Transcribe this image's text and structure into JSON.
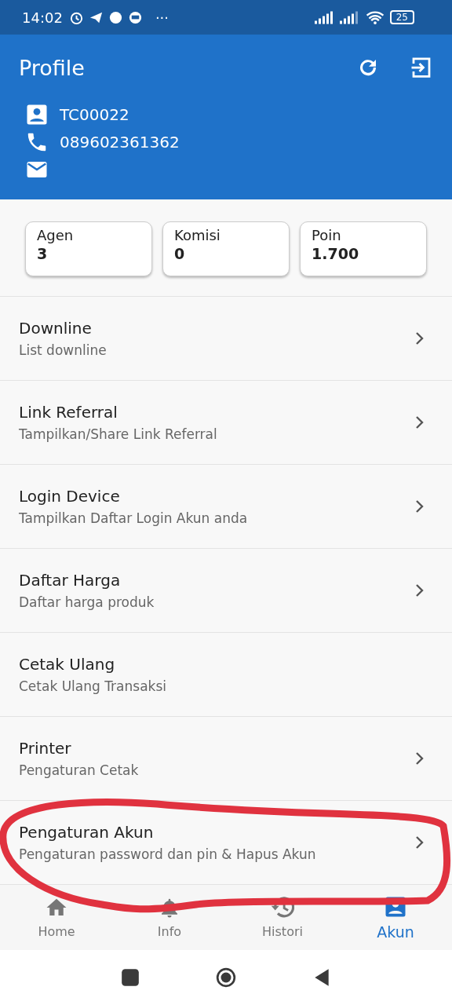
{
  "status_bar": {
    "time": "14:02",
    "more": "···",
    "battery": "25"
  },
  "header": {
    "title": "Profile",
    "user_id": "TC00022",
    "phone": "089602361362"
  },
  "stats": [
    {
      "label": "Agen",
      "value": "3"
    },
    {
      "label": "Komisi",
      "value": "0"
    },
    {
      "label": "Poin",
      "value": "1.700"
    }
  ],
  "menu": [
    {
      "title": "Downline",
      "subtitle": "List downline",
      "chevron": true
    },
    {
      "title": "Link Referral",
      "subtitle": "Tampilkan/Share Link Referral",
      "chevron": true
    },
    {
      "title": "Login Device",
      "subtitle": "Tampilkan Daftar Login Akun anda",
      "chevron": true
    },
    {
      "title": "Daftar Harga",
      "subtitle": "Daftar harga produk",
      "chevron": true
    },
    {
      "title": "Cetak Ulang",
      "subtitle": "Cetak Ulang Transaksi",
      "chevron": false
    },
    {
      "title": "Printer",
      "subtitle": "Pengaturan Cetak",
      "chevron": true
    },
    {
      "title": "Pengaturan Akun",
      "subtitle": "Pengaturan password dan pin & Hapus Akun",
      "chevron": true
    }
  ],
  "bottom_nav": [
    {
      "label": "Home",
      "kind": "home",
      "selected": false
    },
    {
      "label": "Info",
      "kind": "bell",
      "selected": false
    },
    {
      "label": "Histori",
      "kind": "history",
      "selected": false
    },
    {
      "label": "Akun",
      "kind": "account",
      "selected": true
    }
  ]
}
